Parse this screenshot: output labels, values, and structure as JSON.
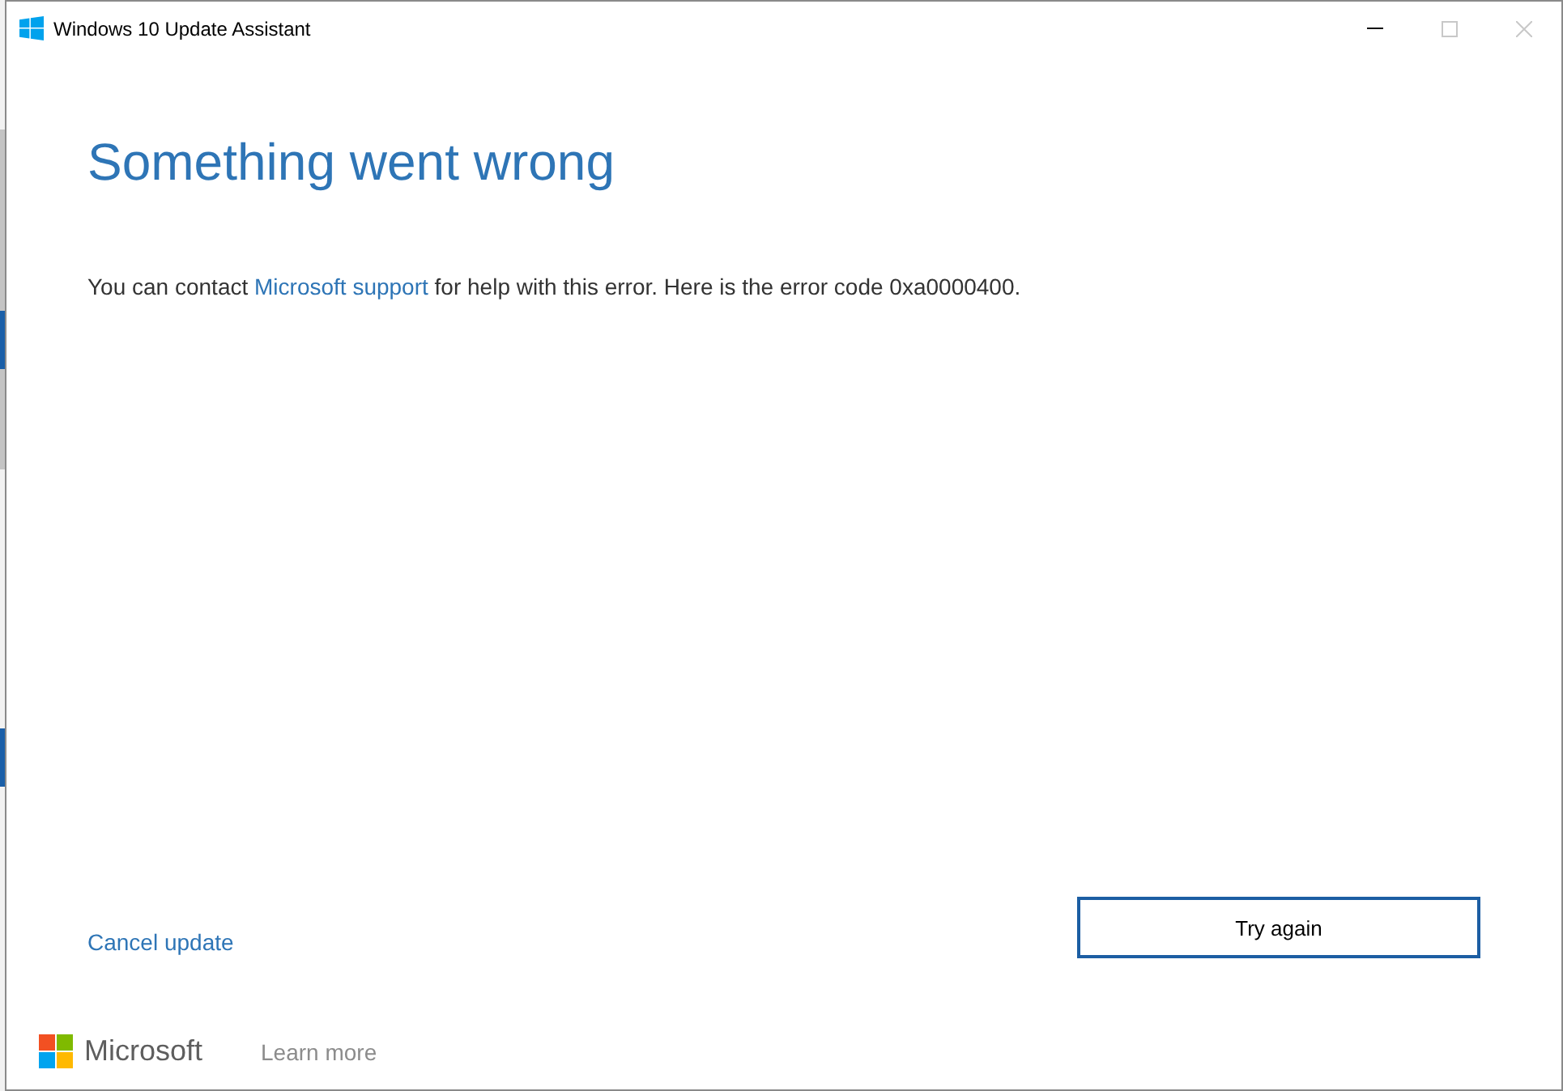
{
  "window": {
    "title": "Windows 10 Update Assistant",
    "controls": [
      {
        "kind": "minimize",
        "disabled": false
      },
      {
        "kind": "maximize",
        "disabled": true
      },
      {
        "kind": "close",
        "disabled": true
      }
    ]
  },
  "heading": "Something went wrong",
  "message": {
    "before": "You can contact ",
    "link": "Microsoft support",
    "after": " for help with this error. Here is the error code 0xa0000400."
  },
  "cancel_link": "Cancel update",
  "primary_button": "Try again",
  "footer": {
    "brand": "Microsoft",
    "learn_more": "Learn more"
  }
}
